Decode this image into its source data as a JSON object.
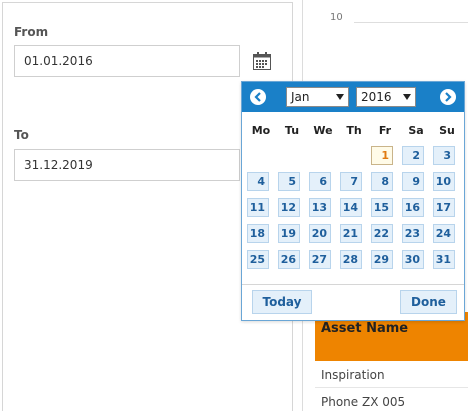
{
  "filters": {
    "from_label": "From",
    "from_value": "01.01.2016",
    "to_label": "To",
    "to_value": "31.12.2019"
  },
  "chart_axis": {
    "tick": "10"
  },
  "datepicker": {
    "month": "Jan",
    "year": "2016",
    "weekdays": [
      "Mo",
      "Tu",
      "We",
      "Th",
      "Fr",
      "Sa",
      "Su"
    ],
    "days": [
      [
        "",
        "",
        "",
        "",
        "1",
        "2",
        "3"
      ],
      [
        "4",
        "5",
        "6",
        "7",
        "8",
        "9",
        "10"
      ],
      [
        "11",
        "12",
        "13",
        "14",
        "15",
        "16",
        "17"
      ],
      [
        "18",
        "19",
        "20",
        "21",
        "22",
        "23",
        "24"
      ],
      [
        "25",
        "26",
        "27",
        "28",
        "29",
        "30",
        "31"
      ]
    ],
    "selected_day": "1",
    "today_label": "Today",
    "done_label": "Done",
    "prev_icon": "chevron-left-icon",
    "next_icon": "chevron-right-icon",
    "header_color": "#1a80c8"
  },
  "table": {
    "header": "Asset Name",
    "header_color": "#ee8400",
    "rows": [
      "Inspiration",
      "Phone ZX 005"
    ]
  }
}
